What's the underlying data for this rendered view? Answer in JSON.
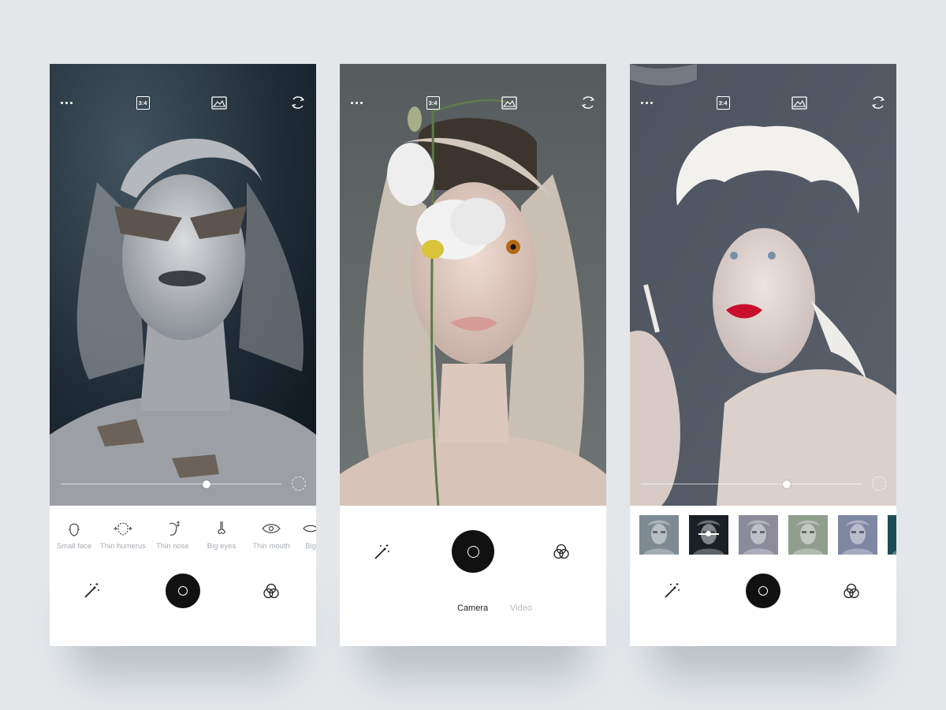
{
  "topbar": {
    "ratio_label": "3:4"
  },
  "screen1": {
    "beauty_tools": [
      {
        "label": "Small face"
      },
      {
        "label": "Thin humerus"
      },
      {
        "label": "Thin nose"
      },
      {
        "label": "Big eyes"
      },
      {
        "label": "Thin mouth"
      },
      {
        "label": "Big"
      }
    ],
    "slider_value": 0.66
  },
  "screen2": {
    "modes": [
      {
        "label": "Camera",
        "active": true
      },
      {
        "label": "Video",
        "active": false
      }
    ]
  },
  "screen3": {
    "slider_value": 0.66,
    "filters": [
      {
        "name": "filter-1",
        "tint": "#7d8a92"
      },
      {
        "name": "filter-2",
        "tint": "#1b2027",
        "selected": true
      },
      {
        "name": "filter-3",
        "tint": "#8b8b9c"
      },
      {
        "name": "filter-4",
        "tint": "#8f9f8c"
      },
      {
        "name": "filter-5",
        "tint": "#7f88a3"
      },
      {
        "name": "filter-6",
        "tint": "#1c4d57"
      }
    ]
  },
  "colors": {
    "shutter": "#111111",
    "label_muted": "#a7acb2",
    "lips_red": "#c8102e"
  },
  "icons": [
    "more-dots-icon",
    "aspect-ratio-icon",
    "gallery-icon",
    "switch-camera-icon",
    "magic-wand-icon",
    "color-filter-icon"
  ]
}
